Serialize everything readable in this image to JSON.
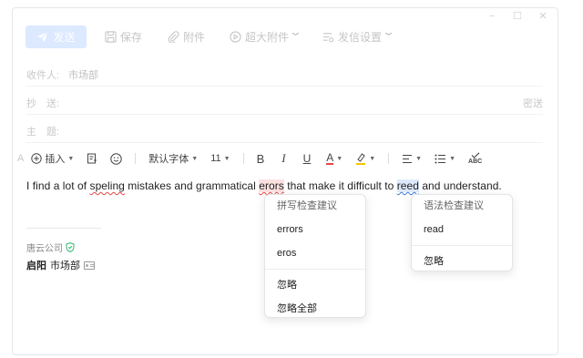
{
  "window_controls": {
    "minimize": "−",
    "maximize": "☐",
    "close": "✕"
  },
  "toolbar": {
    "send_label": "发送",
    "save_label": "保存",
    "attach_label": "附件",
    "big_attach_label": "超大附件",
    "send_settings_label": "发信设置"
  },
  "header": {
    "to_label": "收件人:",
    "to_value": "市场部",
    "cc_label": "抄　送:",
    "bcc_label": "密送",
    "subject_label": "主　题:"
  },
  "format": {
    "insert_label": "插入",
    "font_label": "默认字体",
    "size_label": "11",
    "bold": "B",
    "italic": "I",
    "underline": "U",
    "font_color": "A",
    "font_color_hex": "#e34848",
    "highlight_hex": "#f2c200",
    "spellcheck_label": "ABC"
  },
  "body": {
    "t1": "I find a lot of ",
    "err1": "speling",
    "t2": " mistakes and grammatical ",
    "err2": "erors",
    "t3": " that make it difficult to ",
    "err3": "reed",
    "t4": " and understand."
  },
  "signature": {
    "company": "唐云公司",
    "name": "启阳",
    "dept": "市场部"
  },
  "spell_popup": {
    "title": "拼写检查建议",
    "suggestions": [
      "errors",
      "eros"
    ],
    "ignore": "忽略",
    "ignore_all": "忽略全部"
  },
  "grammar_popup": {
    "title": "语法检查建议",
    "suggestions": [
      "read"
    ],
    "ignore": "忽略"
  },
  "colors": {
    "send_button_bg": "#dce9ff",
    "spelling_error": "#e34848",
    "grammar_error": "#3d7bd9",
    "verified_green": "#2fb36b"
  }
}
